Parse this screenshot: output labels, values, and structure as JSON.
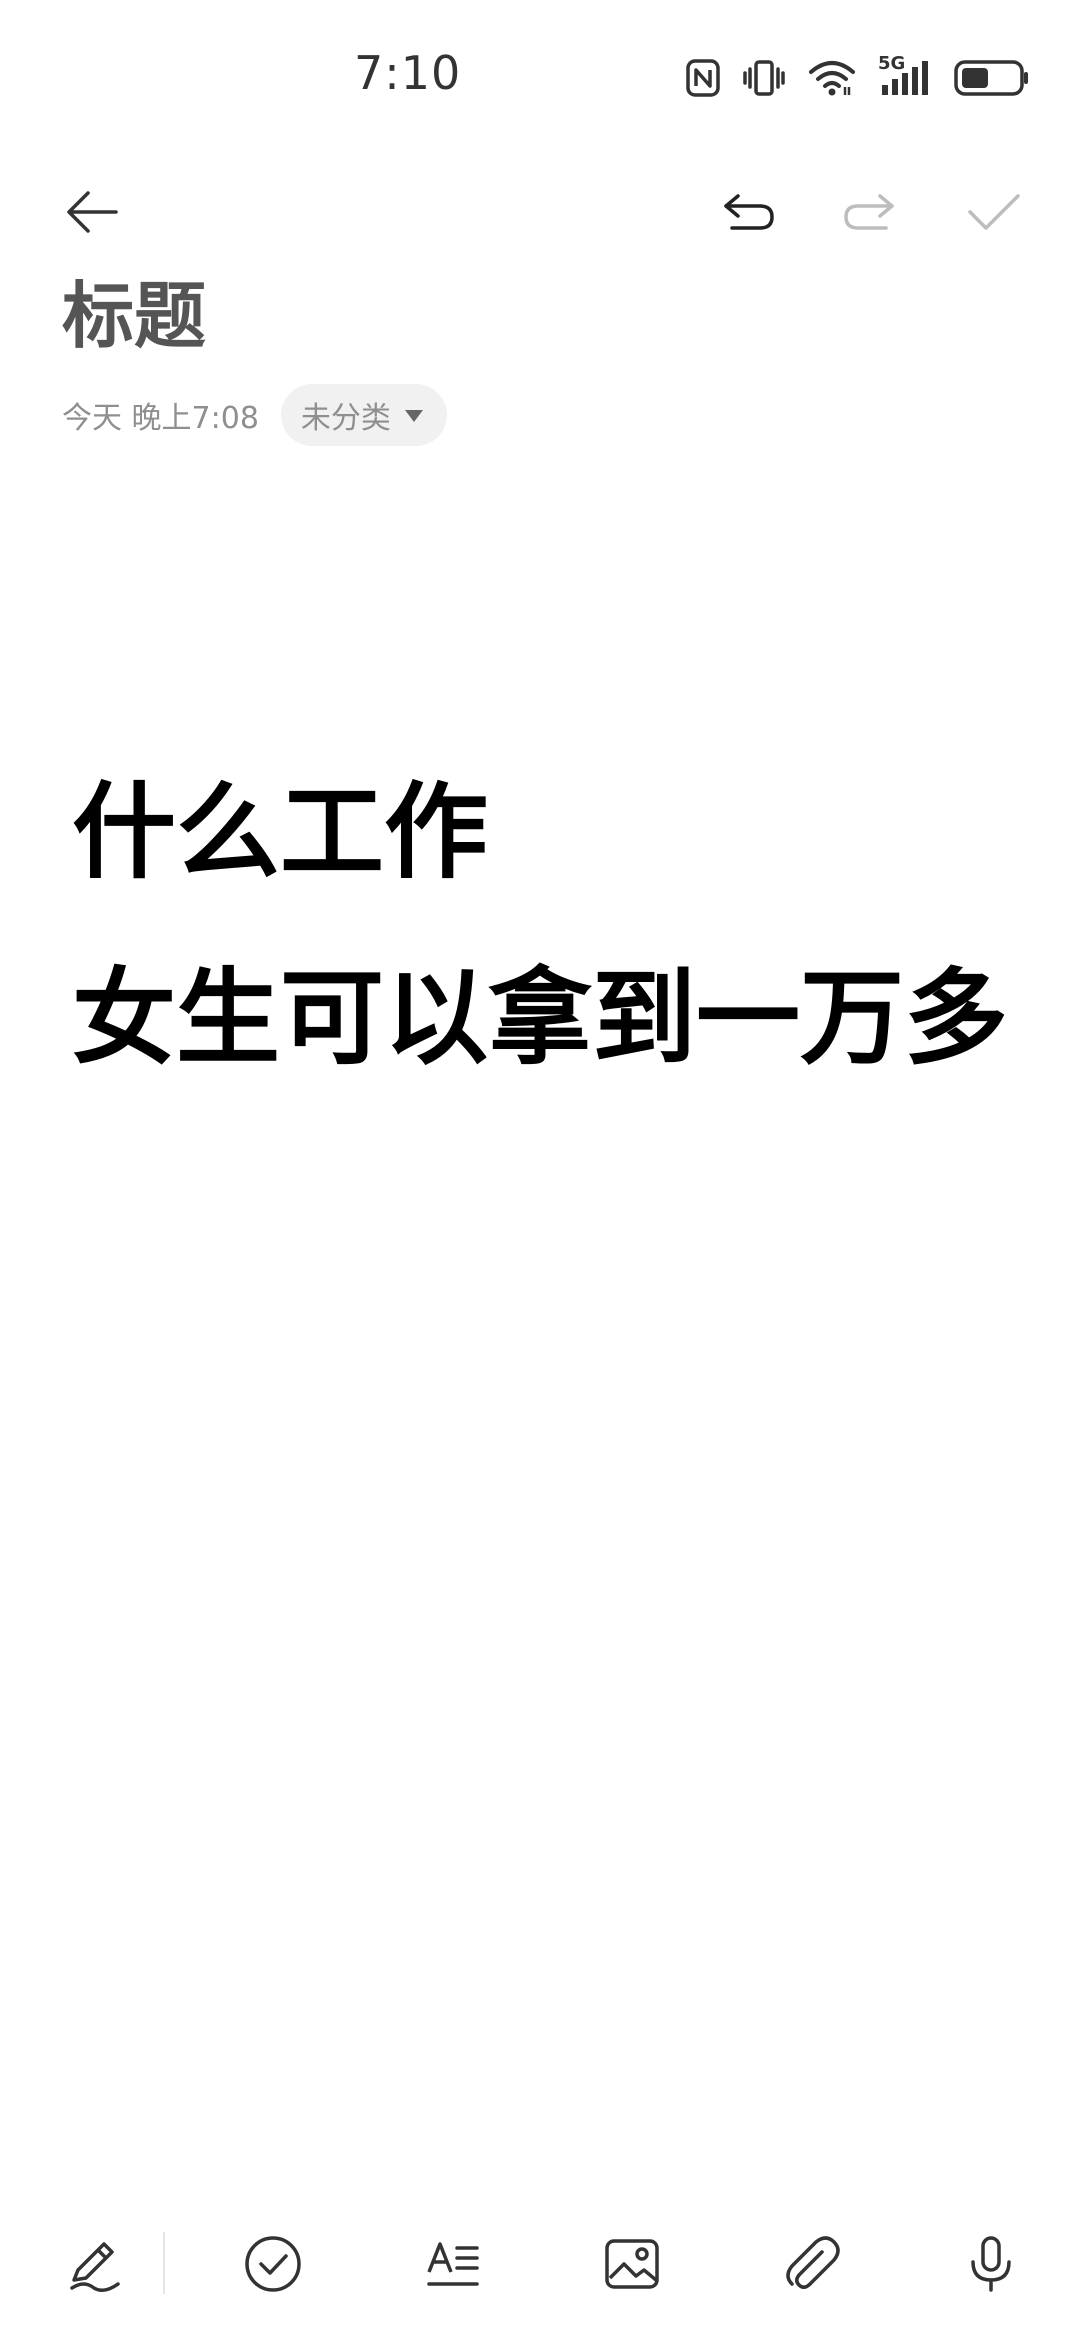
{
  "status_bar": {
    "time": "7:10",
    "network": "5G",
    "battery_level": 0.45
  },
  "note": {
    "title": "标题",
    "date": "今天 晚上7:08",
    "category": "未分类",
    "lines": [
      "什么工作",
      "女生可以拿到一万多"
    ]
  },
  "icons": {
    "back": "arrow-left-icon",
    "undo": "undo-icon",
    "redo": "redo-icon",
    "done": "check-icon",
    "handwriting": "pen-icon",
    "checklist": "check-circle-icon",
    "text_format": "text-format-icon",
    "image": "image-icon",
    "attachment": "paperclip-icon",
    "voice": "microphone-icon"
  },
  "colors": {
    "title": "#555555",
    "meta_text": "#8f8f8f",
    "chip_bg": "#f1f1f1",
    "disabled_icon": "#bdbdbd",
    "icon": "#333333"
  }
}
